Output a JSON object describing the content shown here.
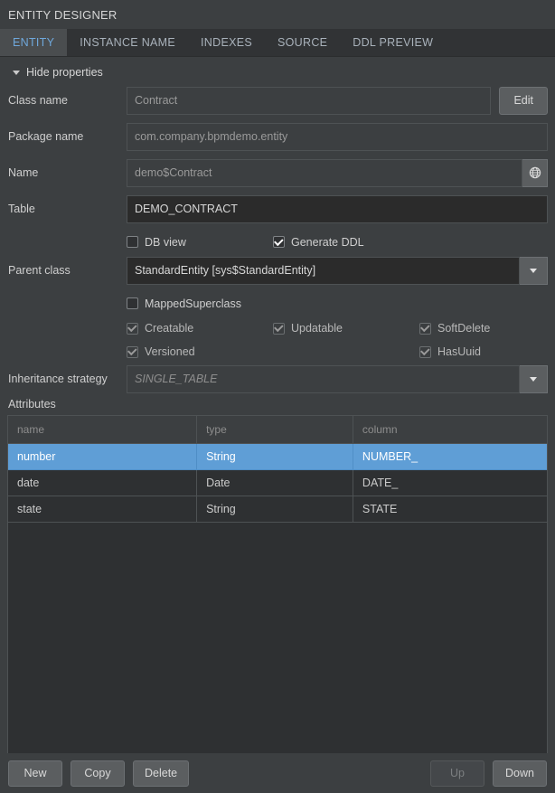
{
  "window": {
    "title": "ENTITY DESIGNER"
  },
  "tabs": [
    {
      "label": "ENTITY",
      "active": true
    },
    {
      "label": "INSTANCE NAME",
      "active": false
    },
    {
      "label": "INDEXES",
      "active": false
    },
    {
      "label": "SOURCE",
      "active": false
    },
    {
      "label": "DDL PREVIEW",
      "active": false
    }
  ],
  "properties_toggle": {
    "label": "Hide properties",
    "icon": "triangle-down-icon",
    "expanded": true
  },
  "form": {
    "class_name": {
      "label": "Class name",
      "value": "Contract",
      "readonly": true,
      "button_label": "Edit"
    },
    "package_name": {
      "label": "Package name",
      "value": "com.company.bpmdemo.entity",
      "readonly": true
    },
    "name": {
      "label": "Name",
      "value": "demo$Contract",
      "readonly": true,
      "icon": "globe-icon"
    },
    "table": {
      "label": "Table",
      "value": "DEMO_CONTRACT",
      "readonly": false
    },
    "db_view": {
      "label": "DB view",
      "checked": false
    },
    "generate_ddl": {
      "label": "Generate DDL",
      "checked": true
    },
    "parent_class": {
      "label": "Parent class",
      "value": "StandardEntity [sys$StandardEntity]",
      "icon": "chevron-down-icon"
    },
    "mapped_superclass": {
      "label": "MappedSuperclass",
      "checked": false
    },
    "traits": [
      {
        "label": "Creatable",
        "checked": true,
        "disabled": true
      },
      {
        "label": "Updatable",
        "checked": true,
        "disabled": true
      },
      {
        "label": "SoftDelete",
        "checked": true,
        "disabled": true
      },
      {
        "label": "Versioned",
        "checked": true,
        "disabled": true
      },
      {
        "label": "HasUuid",
        "checked": true,
        "disabled": true
      }
    ],
    "inheritance_strategy": {
      "label": "Inheritance strategy",
      "placeholder": "SINGLE_TABLE",
      "value": "",
      "icon": "chevron-down-icon"
    }
  },
  "attributes": {
    "section_label": "Attributes",
    "columns": [
      "name",
      "type",
      "column"
    ],
    "rows": [
      {
        "name": "number",
        "type": "String",
        "column": "NUMBER_",
        "selected": true
      },
      {
        "name": "date",
        "type": "Date",
        "column": "DATE_",
        "selected": false
      },
      {
        "name": "state",
        "type": "String",
        "column": "STATE",
        "selected": false
      }
    ]
  },
  "footer": {
    "new_label": "New",
    "copy_label": "Copy",
    "delete_label": "Delete",
    "up_label": "Up",
    "up_disabled": true,
    "down_label": "Down",
    "down_disabled": false
  },
  "colors": {
    "background": "#3c3f41",
    "tabbar": "#313335",
    "tab_active_bg": "#4a4d4f",
    "tab_active_text": "#6fa8dc",
    "selection_blue": "#5f9ed6",
    "field_bg": "#2b2b2b",
    "border": "#4e5254"
  }
}
